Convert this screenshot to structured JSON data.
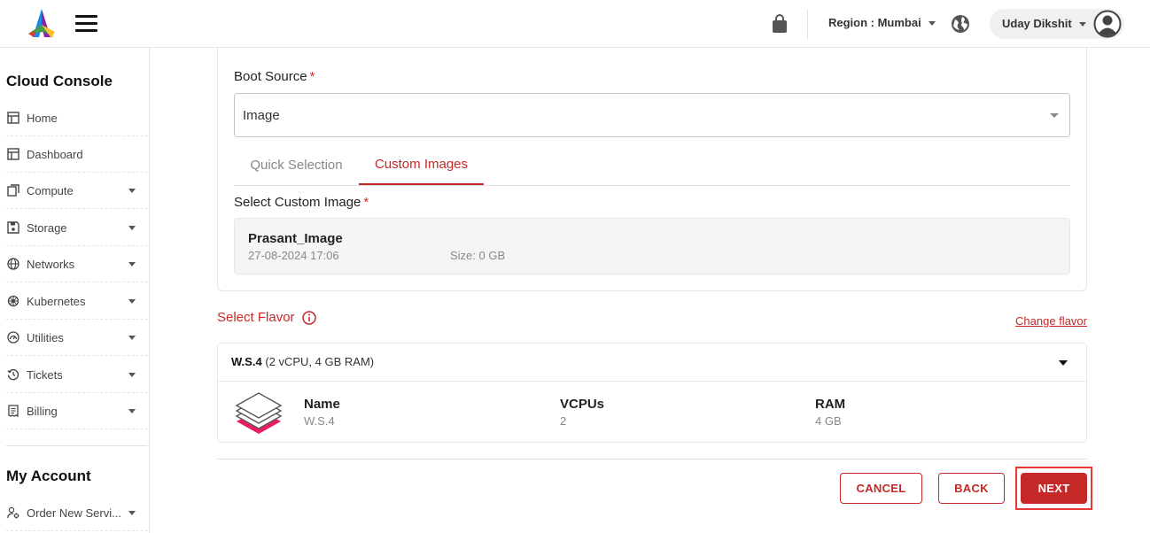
{
  "header": {
    "region_label": "Region : Mumbai",
    "user_name": "Uday Dikshit"
  },
  "sidebar": {
    "console_heading": "Cloud Console",
    "items": [
      {
        "label": "Home",
        "icon": "layout-icon"
      },
      {
        "label": "Dashboard",
        "icon": "layout-icon"
      },
      {
        "label": "Compute",
        "icon": "copy-icon"
      },
      {
        "label": "Storage",
        "icon": "save-icon"
      },
      {
        "label": "Networks",
        "icon": "globe-icon"
      },
      {
        "label": "Kubernetes",
        "icon": "helm-icon"
      },
      {
        "label": "Utilities",
        "icon": "gauge-icon"
      },
      {
        "label": "Tickets",
        "icon": "history-icon"
      },
      {
        "label": "Billing",
        "icon": "receipt-icon"
      }
    ],
    "account_heading": "My Account",
    "account_items": [
      {
        "label": "Order New Servi...",
        "icon": "user-gear-icon"
      }
    ]
  },
  "boot_source": {
    "label": "Boot Source",
    "required_mark": "*",
    "value": "Image"
  },
  "tabs": {
    "quick": "Quick Selection",
    "custom": "Custom Images"
  },
  "custom_image": {
    "label": "Select Custom Image",
    "required_mark": "*",
    "name": "Prasant_Image",
    "date": "27-08-2024 17:06",
    "size": "Size: 0 GB"
  },
  "flavor": {
    "title": "Select Flavor",
    "change_link": "Change flavor",
    "selected_name": "W.S.4",
    "selected_spec": "(2 vCPU, 4 GB RAM)",
    "columns": [
      {
        "header": "Name",
        "value": "W.S.4"
      },
      {
        "header": "VCPUs",
        "value": "2"
      },
      {
        "header": "RAM",
        "value": "4 GB"
      }
    ]
  },
  "actions": {
    "cancel": "CANCEL",
    "back": "BACK",
    "next": "NEXT"
  },
  "colors": {
    "accent": "#c62828",
    "highlight_frame": "#e53935",
    "flavor_icon_accent": "#e91e63"
  }
}
